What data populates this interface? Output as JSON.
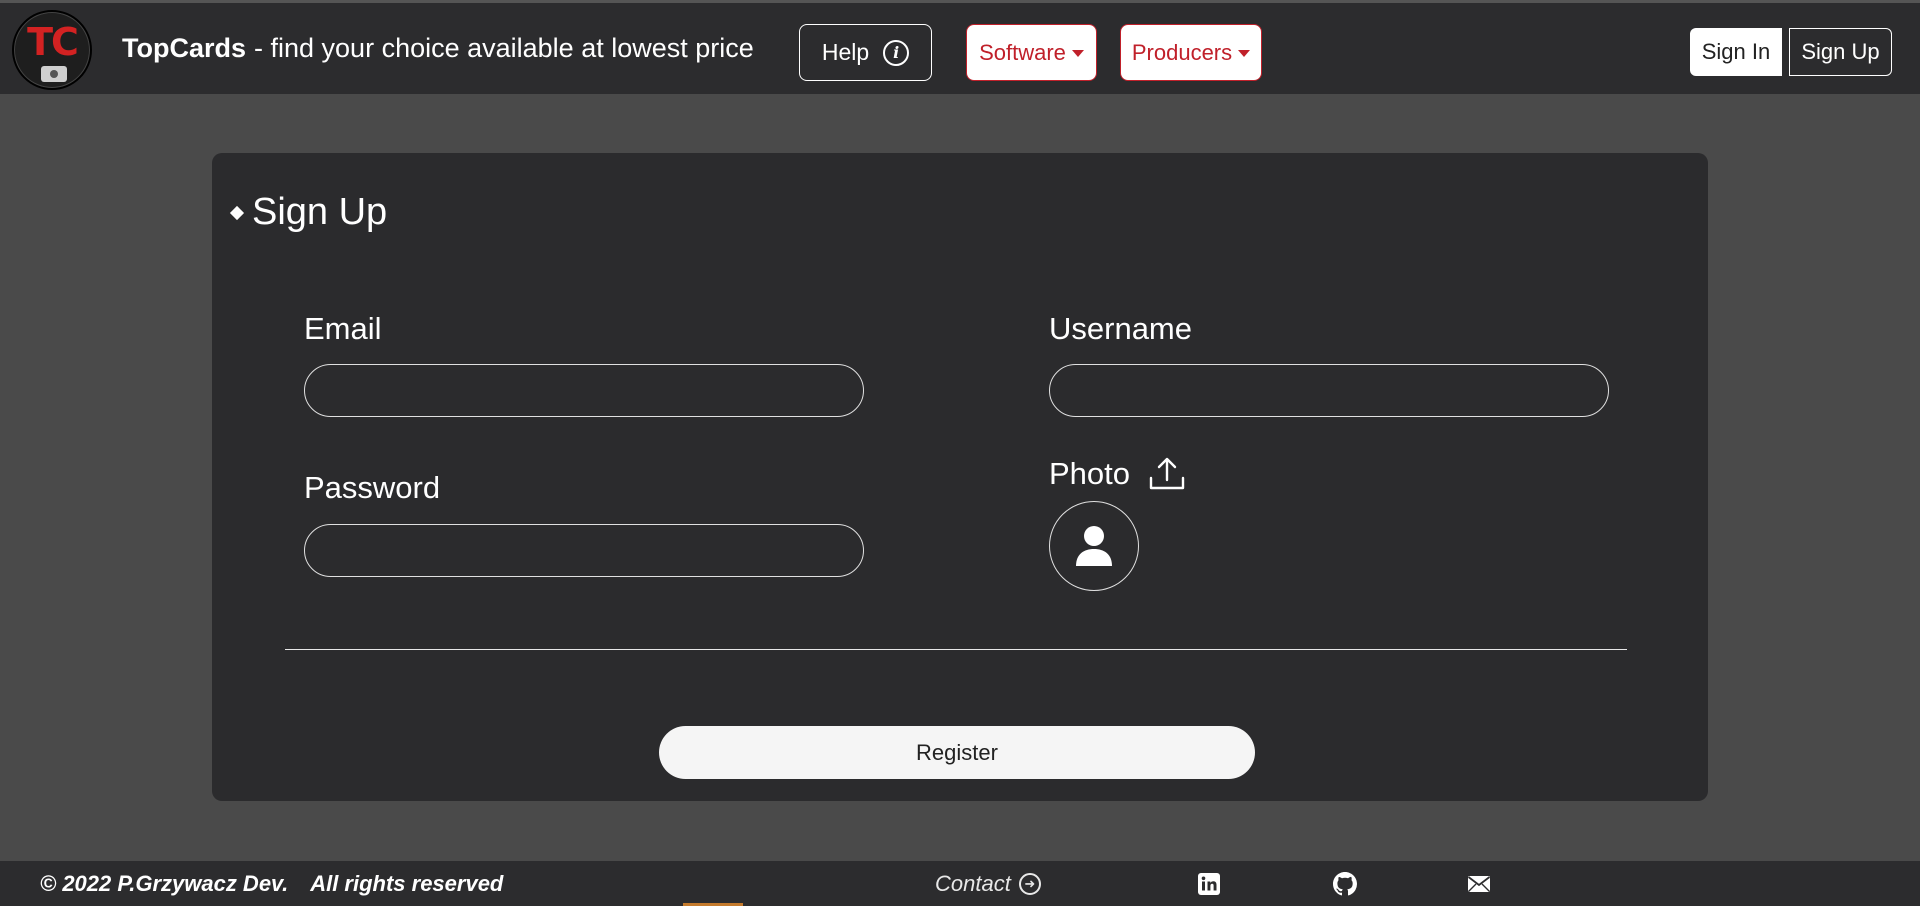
{
  "header": {
    "logo_text": "TC",
    "brand_name": "TopCards",
    "tagline": "- find your choice available at lowest price",
    "help_label": "Help",
    "software_label": "Software",
    "producers_label": "Producers",
    "sign_in_label": "Sign In",
    "sign_up_label": "Sign Up"
  },
  "form": {
    "title": "Sign Up",
    "email_label": "Email",
    "email_value": "",
    "username_label": "Username",
    "username_value": "",
    "password_label": "Password",
    "password_value": "",
    "photo_label": "Photo",
    "register_label": "Register"
  },
  "footer": {
    "copyright": "© 2022 P.Grzywacz Dev.",
    "rights": "All rights reserved",
    "contact_label": "Contact"
  },
  "icons": {
    "info": "info-icon",
    "caret": "chevron-down-icon",
    "upload": "upload-icon",
    "avatar": "person-icon",
    "contact_arrow": "arrow-right-circle-icon",
    "linkedin": "linkedin-icon",
    "github": "github-icon",
    "mail": "envelope-icon"
  },
  "colors": {
    "page_bg": "#4a4a4a",
    "bar_bg": "#2c2c2e",
    "card_bg": "#2b2b2d",
    "accent_red": "#c0202a",
    "white": "#ffffff"
  }
}
